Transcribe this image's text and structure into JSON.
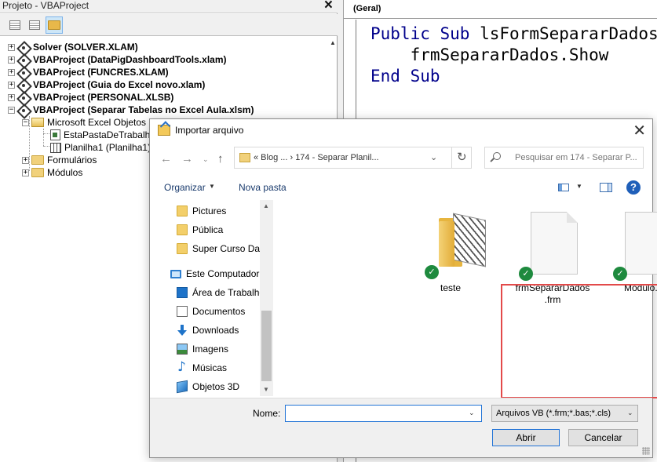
{
  "project_pane": {
    "title": "Projeto - VBAProject",
    "close": "×",
    "tree": [
      {
        "label": "Solver (SOLVER.XLAM)",
        "expander": "+"
      },
      {
        "label": "VBAProject (DataPigDashboardTools.xlam)",
        "expander": "+"
      },
      {
        "label": "VBAProject (FUNCRES.XLAM)",
        "expander": "+"
      },
      {
        "label": "VBAProject (Guia do Excel novo.xlam)",
        "expander": "+"
      },
      {
        "label": "VBAProject (PERSONAL.XLSB)",
        "expander": "+"
      },
      {
        "label": "VBAProject (Separar Tabelas no Excel Aula.xlsm)",
        "expander": "−"
      }
    ],
    "sub": {
      "excel_objects": "Microsoft Excel Objetos",
      "this_workbook": "EstaPastaDeTrabalho",
      "sheet1": "Planilha1 (Planilha1)",
      "forms": "Formulários",
      "modules": "Módulos"
    }
  },
  "code_pane": {
    "object_combo": "(Geral)",
    "line1_kw1": "Public",
    "line1_kw2": "Sub",
    "line1_name": "lsFormSepararDados",
    "line2": "frmSepararDados.Show",
    "line3_kw1": "End",
    "line3_kw2": "Sub"
  },
  "dialog": {
    "title": "Importar arquivo",
    "close": "✕",
    "address": {
      "path": "«  Blog ...   ›   174 - Separar Planil...",
      "dropdown": "⌄"
    },
    "search_placeholder": "Pesquisar em 174 - Separar P...",
    "toolbar": {
      "organize": "Organizar",
      "new_folder": "Nova pasta",
      "help": "?"
    },
    "nav": [
      {
        "label": "Pictures"
      },
      {
        "label": "Pública"
      },
      {
        "label": "Super Curso Das"
      },
      {
        "label": "Este Computador"
      },
      {
        "label": "Área de Trabalho"
      },
      {
        "label": "Documentos"
      },
      {
        "label": "Downloads"
      },
      {
        "label": "Imagens"
      },
      {
        "label": "Músicas"
      },
      {
        "label": "Objetos 3D"
      }
    ],
    "files": [
      {
        "label": "teste"
      },
      {
        "label_line1": "frmSepararDados",
        "label_line2": ".frm"
      },
      {
        "label": "Modulo.bas"
      }
    ],
    "name_label": "Nome:",
    "name_value": "",
    "filter": "Arquivos VB (*.frm;*.bas;*.cls)",
    "open_button": "Abrir",
    "cancel_button": "Cancelar"
  },
  "colors": {
    "highlight": "#e34a4a",
    "keyword": "#00008b",
    "focus_border": "#2173d6"
  }
}
